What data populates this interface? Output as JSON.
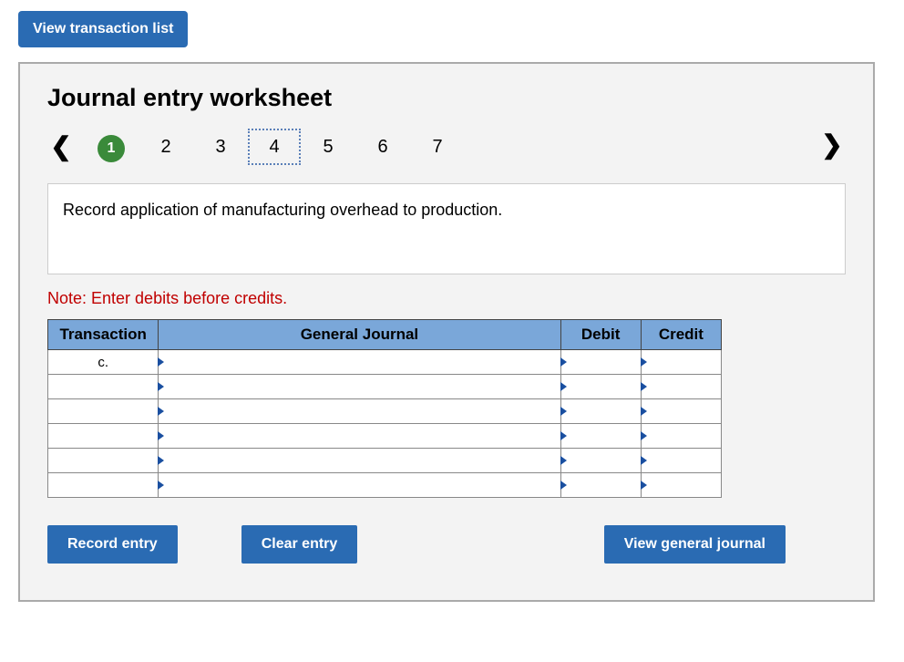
{
  "top_button": "View transaction list",
  "title": "Journal entry worksheet",
  "pager": {
    "items": [
      "1",
      "2",
      "3",
      "4",
      "5",
      "6",
      "7"
    ],
    "active_index": 0,
    "focus_index": 3
  },
  "instruction": "Record application of manufacturing overhead to production.",
  "note": "Note: Enter debits before credits.",
  "table": {
    "headers": {
      "transaction": "Transaction",
      "general_journal": "General Journal",
      "debit": "Debit",
      "credit": "Credit"
    },
    "rows": [
      {
        "transaction": "c.",
        "general_journal": "",
        "debit": "",
        "credit": ""
      },
      {
        "transaction": "",
        "general_journal": "",
        "debit": "",
        "credit": ""
      },
      {
        "transaction": "",
        "general_journal": "",
        "debit": "",
        "credit": ""
      },
      {
        "transaction": "",
        "general_journal": "",
        "debit": "",
        "credit": ""
      },
      {
        "transaction": "",
        "general_journal": "",
        "debit": "",
        "credit": ""
      },
      {
        "transaction": "",
        "general_journal": "",
        "debit": "",
        "credit": ""
      }
    ]
  },
  "buttons": {
    "record": "Record entry",
    "clear": "Clear entry",
    "view_gj": "View general journal"
  }
}
